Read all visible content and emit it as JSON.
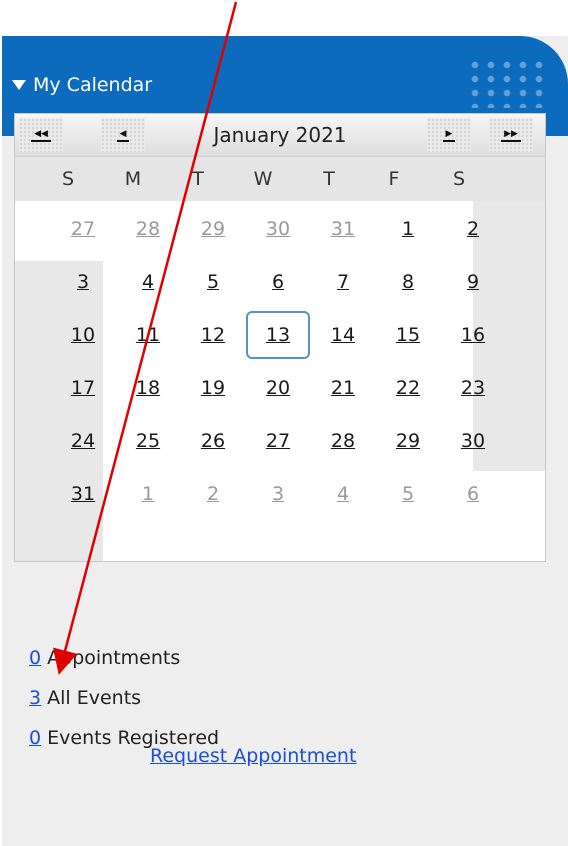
{
  "header": {
    "title": "My Calendar"
  },
  "calendar": {
    "month_title": "January 2021",
    "nav": {
      "prev_year": "◀◀",
      "prev_month": "◀",
      "next_month": "▶",
      "next_year": "▶▶"
    },
    "weekdays": [
      "S",
      "M",
      "T",
      "W",
      "T",
      "F",
      "S"
    ],
    "weeks": [
      [
        {
          "d": "27",
          "cur": false
        },
        {
          "d": "28",
          "cur": false
        },
        {
          "d": "29",
          "cur": false
        },
        {
          "d": "30",
          "cur": false
        },
        {
          "d": "31",
          "cur": false
        },
        {
          "d": "1",
          "cur": true
        },
        {
          "d": "2",
          "cur": true
        }
      ],
      [
        {
          "d": "3",
          "cur": true
        },
        {
          "d": "4",
          "cur": true
        },
        {
          "d": "5",
          "cur": true
        },
        {
          "d": "6",
          "cur": true
        },
        {
          "d": "7",
          "cur": true
        },
        {
          "d": "8",
          "cur": true
        },
        {
          "d": "9",
          "cur": true
        }
      ],
      [
        {
          "d": "10",
          "cur": true
        },
        {
          "d": "11",
          "cur": true
        },
        {
          "d": "12",
          "cur": true
        },
        {
          "d": "13",
          "cur": true,
          "today": true
        },
        {
          "d": "14",
          "cur": true
        },
        {
          "d": "15",
          "cur": true
        },
        {
          "d": "16",
          "cur": true
        }
      ],
      [
        {
          "d": "17",
          "cur": true
        },
        {
          "d": "18",
          "cur": true
        },
        {
          "d": "19",
          "cur": true
        },
        {
          "d": "20",
          "cur": true
        },
        {
          "d": "21",
          "cur": true
        },
        {
          "d": "22",
          "cur": true
        },
        {
          "d": "23",
          "cur": true
        }
      ],
      [
        {
          "d": "24",
          "cur": true
        },
        {
          "d": "25",
          "cur": true
        },
        {
          "d": "26",
          "cur": true
        },
        {
          "d": "27",
          "cur": true
        },
        {
          "d": "28",
          "cur": true
        },
        {
          "d": "29",
          "cur": true
        },
        {
          "d": "30",
          "cur": true
        }
      ],
      [
        {
          "d": "31",
          "cur": true
        },
        {
          "d": "1",
          "cur": false
        },
        {
          "d": "2",
          "cur": false
        },
        {
          "d": "3",
          "cur": false
        },
        {
          "d": "4",
          "cur": false
        },
        {
          "d": "5",
          "cur": false
        },
        {
          "d": "6",
          "cur": false
        }
      ]
    ]
  },
  "stats": [
    {
      "count": "0",
      "label": "Appointments"
    },
    {
      "count": "3",
      "label": "All Events"
    },
    {
      "count": "0",
      "label": "Events Registered"
    }
  ],
  "request_link": "Request Appointment",
  "colors": {
    "header_blue": "#0d6bbd",
    "link_blue": "#1a4fd6",
    "annotation_arrow": "#e00000",
    "today_outline": "#5a8fd0"
  }
}
